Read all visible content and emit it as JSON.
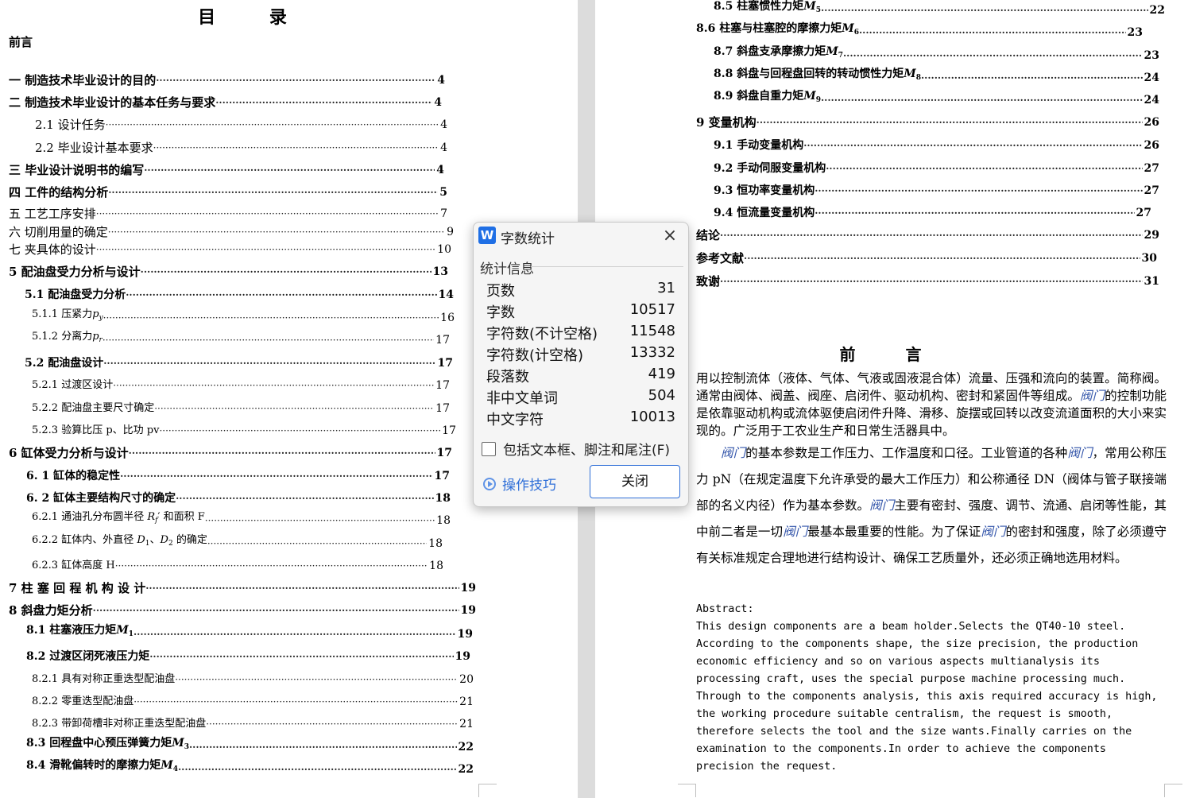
{
  "toc": {
    "title": "目  录",
    "preface": "前言",
    "left_entries": [
      {
        "label": "一   制造技术毕业设计的目的",
        "page": "4"
      },
      {
        "label": "二   制造技术毕业设计的基本任务与要求",
        "page": "4"
      },
      {
        "label": "2.1 设计任务",
        "page": "4"
      },
      {
        "label": "2.2 毕业设计基本要求",
        "page": "4"
      },
      {
        "label": "三   毕业设计说明书的编写",
        "page": "4"
      },
      {
        "label": "四     工件的结构分析",
        "page": "5"
      },
      {
        "label": "五     工艺工序安排",
        "page": "7"
      },
      {
        "label": "六     切削用量的确定",
        "page": "9"
      },
      {
        "label": "七     夹具体的设计",
        "page": "10"
      },
      {
        "label": "5 配油盘受力分析与设计",
        "page": "13"
      },
      {
        "label": "5.1 配油盘受力分析",
        "page": "14"
      },
      {
        "label": "5.1.1 压紧力",
        "page": "16"
      },
      {
        "label": "5.1.2 分离力",
        "page": "17"
      },
      {
        "label": "5.2 配油盘设计",
        "page": "17"
      },
      {
        "label": "5.2.1 过渡区设计",
        "page": "17"
      },
      {
        "label": "5.2.2 配油盘主要尺寸确定",
        "page": "17"
      },
      {
        "label": "5.2.3 验算比压 p、比功 pv",
        "page": "17"
      },
      {
        "label": "6 缸体受力分析与设计",
        "page": "17"
      },
      {
        "label": "6. 1 缸体的稳定性",
        "page": "17"
      },
      {
        "label": "6. 2 缸体主要结构尺寸的确定",
        "page": "18"
      },
      {
        "label": "6.2.1 通油孔分布圆半径",
        "page": "18"
      },
      {
        "label": "6.2.2 缸体内、外直径",
        "page": "18"
      },
      {
        "label": "6.2.3 缸体高度 H",
        "page": "18"
      },
      {
        "label": "7 柱 塞 回 程 机 构 设 计",
        "page": "19"
      },
      {
        "label": "8 斜盘力矩分析",
        "page": "19"
      },
      {
        "label": "8.1 柱塞液压力矩",
        "page": "19"
      },
      {
        "label": "8.2 过渡区闭死液压力矩",
        "page": "19"
      },
      {
        "label": "8.2.1 具有对称正重迭型配油盘",
        "page": "20"
      },
      {
        "label": "8.2.2 零重迭型配油盘",
        "page": "21"
      },
      {
        "label": "8.2.3 带卸荷槽非对称正重迭型配油盘",
        "page": "21"
      },
      {
        "label": "8.3 回程盘中心预压弹簧力矩",
        "page": "22"
      },
      {
        "label": "8.4 滑靴偏转时的摩擦力矩",
        "page": "22"
      }
    ],
    "math": {
      "p": "p",
      "sub_y": "y",
      "sub_r": "r",
      "Rf": "R",
      "sub_f": "f",
      "prime": "′",
      "area_text": " 和面积 F",
      "D": "D",
      "sub_1": "1",
      "sep": "、",
      "sub_2": "2",
      "confirm": " 的确定",
      "M": "M",
      "sub_3": "3",
      "sub_4": "4",
      "sub_5": "5",
      "sub_6": "6",
      "sub_7": "7",
      "sub_8": "8",
      "sub_9": "9"
    },
    "right_entries": [
      {
        "label": "8.5 柱塞惯性力矩",
        "page": "22"
      },
      {
        "label": "8.6 柱塞与柱塞腔的摩擦力矩",
        "page": "23"
      },
      {
        "label": "8.7 斜盘支承摩擦力矩",
        "page": "23"
      },
      {
        "label": "8.8 斜盘与回程盘回转的转动惯性力矩",
        "page": "24"
      },
      {
        "label": "8.9 斜盘自重力矩",
        "page": "24"
      },
      {
        "label": "9  变量机构",
        "page": "26"
      },
      {
        "label": "9.1 手动变量机构",
        "page": "26"
      },
      {
        "label": "9.2 手动伺服变量机构",
        "page": "27"
      },
      {
        "label": "9.3 恒功率变量机构",
        "page": "27"
      },
      {
        "label": "9.4 恒流量变量机构",
        "page": "27"
      },
      {
        "label": "结论",
        "page": "29"
      },
      {
        "label": "参考文献",
        "page": "30"
      },
      {
        "label": "致谢",
        "page": "31"
      }
    ]
  },
  "preface": {
    "title": "前  言",
    "kw": "阀门",
    "p1a": "用以控制流体（液体、气体、气液或固液混合体）流量、压强和流向的装置。简称阀。通常由阀体、阀盖、阀座、启闭件、驱动机构、密封和紧固件等组成。",
    "p1b": "的控制功能是依靠驱动机构或流体驱使启闭件升降、滑移、旋摆或回转以改变流道面积的大小来实现的。广泛用于工农业生产和日常生活器具中。",
    "p2a": "的基本参数是工作压力、工作温度和口径。工业管道的各种",
    "p2b": "，常用公称压力 pN（在规定温度下允许承受的最大工作压力）和公称通径 DN（阀体与管子联接端部的名义内径）作为基本参数。",
    "p2c": "主要有密封、强度、调节、流通、启闭等性能，其中前二者是一切",
    "p2d": "最基本最重要的性能。为了保证",
    "p2e": "的密封和强度，除了必须遵守有关标准规定合理地进行结构设计、确保工艺质量外，还必须正确地选用材料。"
  },
  "abstract": {
    "label": "Abstract:",
    "text": "This design components are a beam holder.Selects the QT40-10 steel. According to the components shape, the size precision, the production economic efficiency and so on various aspects multianalysis its processing craft, uses the special purpose machine processing much. Through to the components analysis, this axis required accuracy is high, the working procedure suitable centralism, the request is smooth, therefore selects the tool and the size wants.Finally carries on the examination to the components.In order to achieve the components precision the request."
  },
  "dialog": {
    "logo": "W",
    "title": "字数统计",
    "close_icon": "×",
    "section": "统计信息",
    "stats": [
      {
        "label": "页数",
        "value": "31"
      },
      {
        "label": "字数",
        "value": "10517"
      },
      {
        "label": "字符数(不计空格)",
        "value": "11548"
      },
      {
        "label": "字符数(计空格)",
        "value": "13332"
      },
      {
        "label": "段落数",
        "value": "419"
      },
      {
        "label": "非中文单词",
        "value": "504"
      },
      {
        "label": "中文字符",
        "value": "10013"
      }
    ],
    "include_label": "包括文本框、脚注和尾注(F)",
    "tips_label": "操作技巧",
    "close_button": "关闭"
  }
}
